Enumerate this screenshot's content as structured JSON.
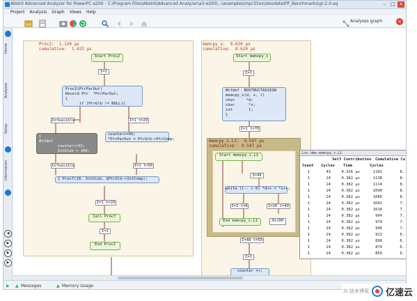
{
  "window": {
    "title": "AbsInt Advanced Analyzer for PowerPC e200 - C:\\Program Files\\AbsInt\\Advanced Analyzer\\a3-e200\\...\\examples\\mpc55xx\\sloodata\\PP_Benchmarks\\gr-2.0.aqx"
  },
  "menu": [
    "Project",
    "Analysis",
    "Graph",
    "Views",
    "Help"
  ],
  "toolbar": {
    "analyses_graph": "Analyses graph"
  },
  "sidebar": {
    "tabs": [
      "Home",
      "Analyses",
      "Setup",
      "Information"
    ]
  },
  "panel1": {
    "header": [
      "Proc2:  1.120 µs",
      "cumulative:  1.022 µs"
    ],
    "nodes": {
      "start": "Start Proc2",
      "i1": "I=1",
      "code1": "Proc2(PtrParOut)\nRecord Ptr  *PtrParOut;\n{\n      if (PtrGlb != NULL){",
      "i1t29": "I=1 t=29",
      "infeasible1": "Infeasible",
      "dark": "}\n#ifdef\n        counter++55;\n        IntGlob = 100;",
      "code2": "counter+=45;\n*PtrParOut = PtrGlb->PtrComp;",
      "infeasible2": "Infeasible",
      "i1t50": "I=1 t=50",
      "code3": "} Proc7(10, IntGlob, &PtrGlb->IntComp);",
      "i1t20": "I=1 t=20",
      "callproc7": "Call Proc7",
      "i1b": "I=1",
      "end": "End Proc2"
    }
  },
  "panel2": {
    "header": [
      "memcpy_s:  0.620 µs",
      "cumulative:  0.620 µs"
    ],
    "nodes": {
      "start": "Start memcpy_s",
      "i1": "I=1",
      "code": "#ifdef  BOSTRUCTASSIGN\nmemcpy_s(d, s, l)\nchar     *d;\nchar      *s;\nint       l;\n{",
      "i1t70": "I=1 t=70"
    },
    "inner": {
      "header": [
        "memcpy_s.L1:  0.547 µs",
        "cumulative:  0.547 µs"
      ],
      "nodes": {
        "start": "Start memcpy_s.L1",
        "i49": "I=49",
        "while": "while (l-- > 0) *d++ = *s++;",
        "i1t8": "I=1 t=8",
        "i10": "I=10 t=49",
        "end": "End memcpy_s.L1",
        "exit": "0x100"
      }
    },
    "i48t50": "I=48 t=50",
    "i1": "I=1",
    "counter": "counter ++;"
  },
  "table": {
    "title": "Loc.dme.memcpy_s.L1",
    "headers": {
      "self": "Self Contribution",
      "cum": "Cumulative Co",
      "count": "Count",
      "cycles": "Cycles",
      "time": "Time",
      "ccycles": "Cycles"
    },
    "rows": [
      {
        "count": "1",
        "cycles": "43",
        "time": "0.326 µs",
        "cum": "1181",
        "cumt": "8."
      },
      {
        "count": "1",
        "cycles": "24",
        "time": "0.382 µs",
        "cum": "1138",
        "cumt": "8."
      },
      {
        "count": "1",
        "cycles": "24",
        "time": "0.382 µs",
        "cum": "1114",
        "cumt": "8."
      },
      {
        "count": "1",
        "cycles": "24",
        "time": "0.382 µs",
        "cum": "1090",
        "cumt": "8."
      },
      {
        "count": "1",
        "cycles": "24",
        "time": "0.382 µs",
        "cum": "1066",
        "cumt": "8."
      },
      {
        "count": "1",
        "cycles": "24",
        "time": "0.382 µs",
        "cum": "1042",
        "cumt": "7."
      },
      {
        "count": "1",
        "cycles": "24",
        "time": "0.382 µs",
        "cum": "1018",
        "cumt": "7."
      },
      {
        "count": "1",
        "cycles": "24",
        "time": "0.382 µs",
        "cum": "994",
        "cumt": "7."
      },
      {
        "count": "1",
        "cycles": "24",
        "time": "0.382 µs",
        "cum": "970",
        "cumt": "7."
      },
      {
        "count": "1",
        "cycles": "24",
        "time": "0.382 µs",
        "cum": "946",
        "cumt": "7."
      },
      {
        "count": "1",
        "cycles": "24",
        "time": "0.382 µs",
        "cum": "922",
        "cumt": "6."
      },
      {
        "count": "1",
        "cycles": "24",
        "time": "0.382 µs",
        "cum": "898",
        "cumt": "6."
      },
      {
        "count": "1",
        "cycles": "24",
        "time": "0.382 µs",
        "cum": "874",
        "cumt": "6."
      },
      {
        "count": "1",
        "cycles": "24",
        "time": "0.382 µs",
        "cum": "850",
        "cumt": "6."
      }
    ]
  },
  "status": {
    "messages": "Messages",
    "memory": "Memory Usage"
  },
  "watermark": {
    "small": "众·技术博客",
    "brand": "亿速云"
  }
}
